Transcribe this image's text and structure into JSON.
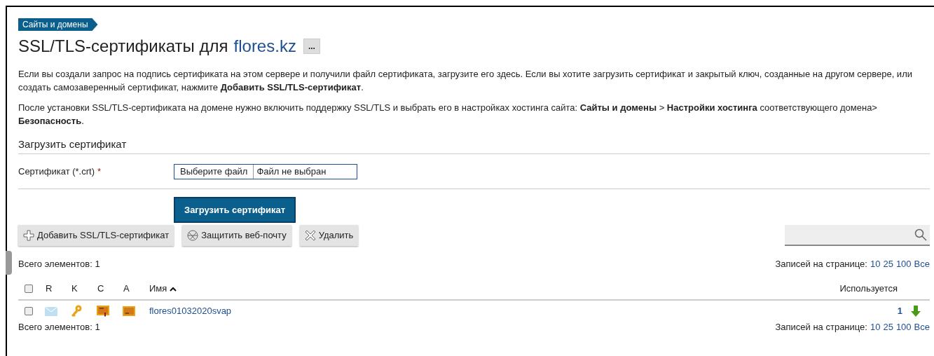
{
  "breadcrumb": "Сайты и домены",
  "title": {
    "prefix": "SSL/TLS-сертификаты для",
    "domain": "flores.kz",
    "more_button": "..."
  },
  "intro_paragraphs": [
    "Если вы создали запрос на подпись сертификата на этом сервере и получили файл сертификата, загрузите его здесь. Если вы хотите загрузить сертификат и закрытый ключ, созданные на другом сервере, или создать самозаверенный сертификат, нажмите **Добавить SSL/TLS-сертификат**.",
    "После установки SSL/TLS-сертификата на домене нужно включить поддержку SSL/TLS и выбрать его в настройках хостинга сайта: **Сайты и домены** > **Настройки хостинга** соответствующего домена> **Безопасность**."
  ],
  "upload_section": {
    "heading": "Загрузить сертификат",
    "field_label": "Сертификат (*.crt)",
    "required_mark": "*",
    "choose_button": "Выберите файл",
    "file_status": "Файл не выбран",
    "submit_button": "Загрузить сертификат"
  },
  "toolbar": [
    {
      "kind": "add",
      "label": "Добавить SSL/TLS-сертификат"
    },
    {
      "kind": "secure",
      "label": "Защитить веб-почту"
    },
    {
      "kind": "delete",
      "label": "Удалить"
    }
  ],
  "total_top": "Всего элементов: 1",
  "per_page_top": {
    "label": "Записей на странице:",
    "options": [
      "10",
      "25",
      "100",
      "Все"
    ]
  },
  "table": {
    "select_all_checked": false,
    "columns": [
      {
        "kind": "flag",
        "label": "R"
      },
      {
        "kind": "flag",
        "label": "K"
      },
      {
        "kind": "flag",
        "label": "C"
      },
      {
        "kind": "flag",
        "label": "A"
      },
      {
        "kind": "name",
        "label": "Имя",
        "sorted_ascending": true
      },
      {
        "kind": "used",
        "label": "Используется"
      }
    ],
    "rows": [
      {
        "checked": false,
        "flags": [
          {
            "kind": "mail"
          },
          {
            "kind": "key"
          },
          {
            "kind": "certificate"
          },
          {
            "kind": "ca"
          }
        ],
        "name": "flores01032020svap",
        "used": "1"
      }
    ]
  },
  "total_bottom": "Всего элементов: 1",
  "per_page_bottom": {
    "label": "Записей на странице:",
    "options": [
      "10",
      "25",
      "100",
      "Все"
    ]
  }
}
